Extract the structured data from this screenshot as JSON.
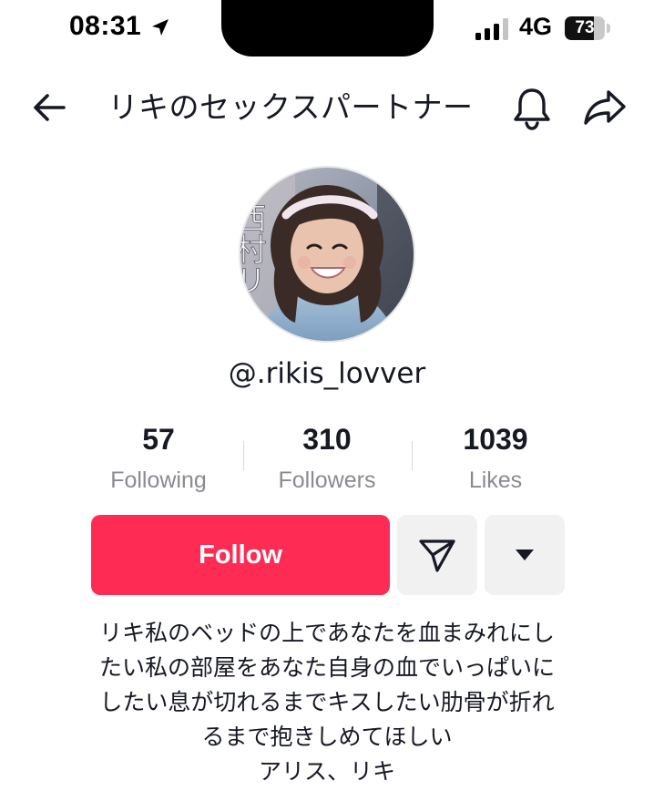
{
  "status_bar": {
    "time": "08:31",
    "network": "4G",
    "battery_level": 73,
    "battery_text": "73"
  },
  "header": {
    "title": "リキのセックスパートナー",
    "icons": [
      "back-arrow-icon",
      "bell-icon",
      "share-icon"
    ]
  },
  "profile": {
    "username": "@.rikis_lovver",
    "avatar_text": "西村リ"
  },
  "stats": [
    {
      "number": "57",
      "label": "Following"
    },
    {
      "number": "310",
      "label": "Followers"
    },
    {
      "number": "1039",
      "label": "Likes"
    }
  ],
  "actions": {
    "follow_label": "Follow",
    "message_icon": "send-message-icon",
    "more_icon": "caret-down-icon"
  },
  "bio": {
    "lines": [
      "リキ私のベッドの上であなたを血まみれにし",
      "たい私の部屋をあなた自身の血でいっぱいに",
      "したい息が切れるまでキスしたい肋骨が折れ",
      "るまで抱きしめてほしい",
      "アリス、リキ"
    ]
  },
  "colors": {
    "follow": "#fe2c55",
    "secondary_button": "#f1f1f2",
    "muted_text": "#8a8b91"
  }
}
